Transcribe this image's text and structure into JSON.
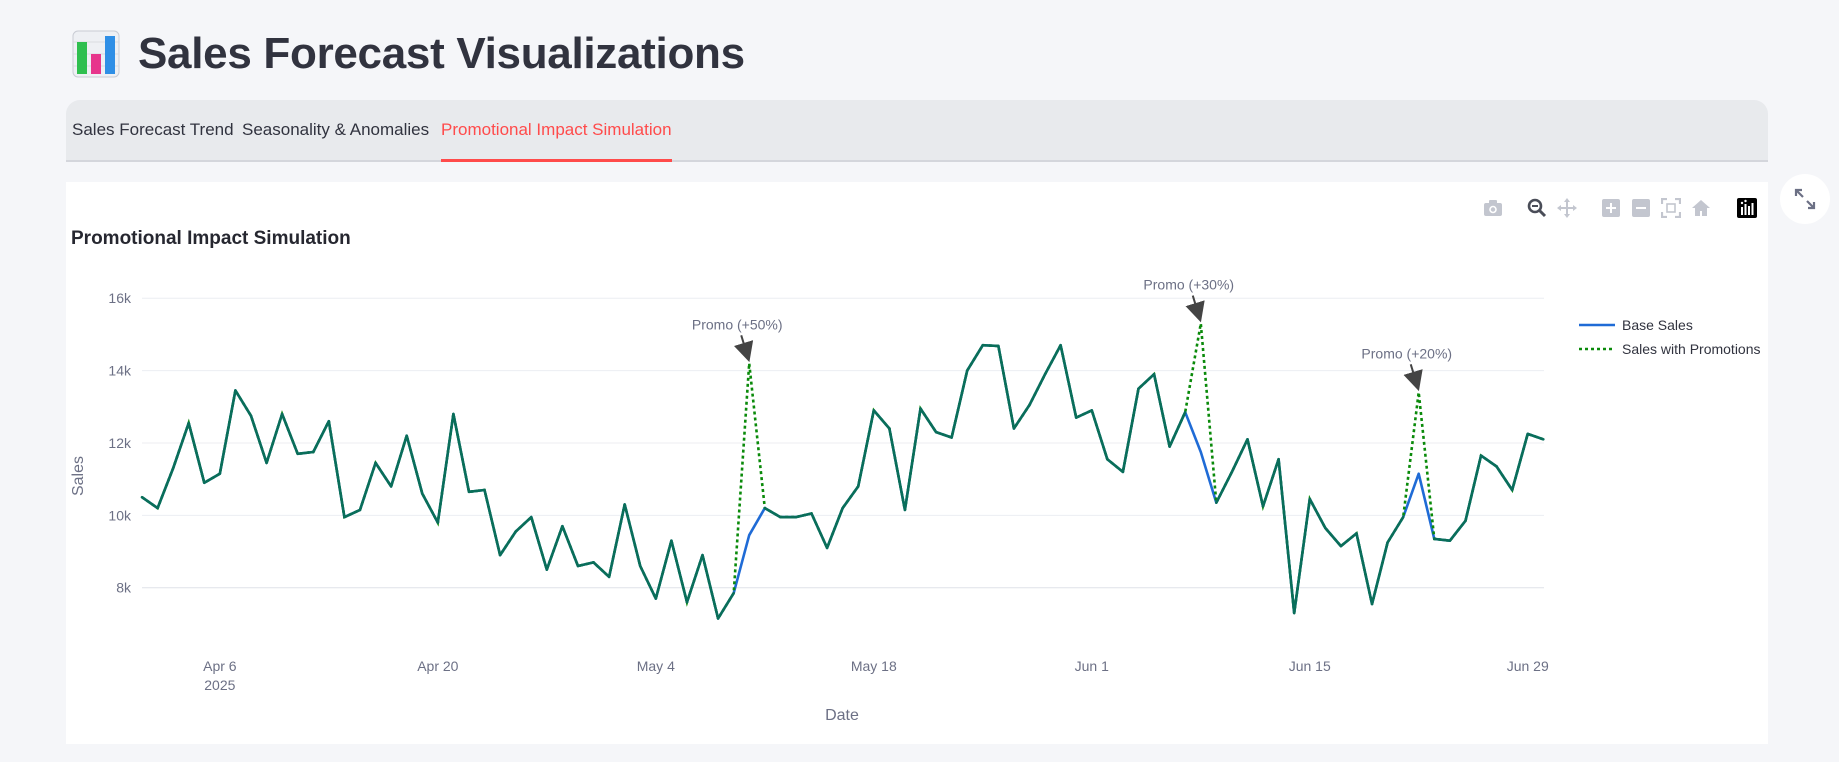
{
  "header": {
    "title": "Sales Forecast Visualizations",
    "logo_icon": "bar-chart-icon"
  },
  "tabs": [
    {
      "label": "Sales Forecast Trend",
      "active": false
    },
    {
      "label": "Seasonality & Anomalies",
      "active": false
    },
    {
      "label": "Promotional Impact Simulation",
      "active": true
    }
  ],
  "colors": {
    "accent": "#ff4b4b",
    "base_sales": "#1f6bd6",
    "promo_sales": "#0a8a0a",
    "overlap": "#0a6e5a"
  },
  "modebar": [
    "camera-icon",
    "zoom-icon",
    "pan-icon",
    "zoom-in-icon",
    "zoom-out-icon",
    "autoscale-icon",
    "reset-axes-icon",
    "plotly-logo-icon"
  ],
  "chart_data": {
    "type": "line",
    "title": "Promotional Impact Simulation",
    "xlabel": "Date",
    "ylabel": "Sales",
    "x_start": "2025-04-01",
    "x_range": [
      "2025-04-01",
      "2025-06-30"
    ],
    "ylim": [
      6500,
      17000
    ],
    "yticks": [
      8000,
      10000,
      12000,
      14000,
      16000
    ],
    "ytick_labels": [
      "8k",
      "10k",
      "12k",
      "14k",
      "16k"
    ],
    "xticks": [
      {
        "date": "2025-04-06",
        "label": "Apr 6",
        "sublabel": "2025"
      },
      {
        "date": "2025-04-20",
        "label": "Apr 20"
      },
      {
        "date": "2025-05-04",
        "label": "May 4"
      },
      {
        "date": "2025-05-18",
        "label": "May 18"
      },
      {
        "date": "2025-06-01",
        "label": "Jun 1"
      },
      {
        "date": "2025-06-15",
        "label": "Jun 15"
      },
      {
        "date": "2025-06-29",
        "label": "Jun 29"
      }
    ],
    "grid": true,
    "legend": "top-right",
    "series": [
      {
        "name": "Base Sales",
        "style": "solid",
        "values": [
          10500,
          10200,
          11300,
          12550,
          10900,
          11150,
          13450,
          12750,
          11450,
          12800,
          11700,
          11750,
          12600,
          9950,
          10150,
          11450,
          10800,
          12200,
          10600,
          9800,
          12800,
          10650,
          10700,
          8900,
          9550,
          9950,
          8500,
          9700,
          8600,
          8700,
          8300,
          10300,
          8600,
          7700,
          9300,
          7600,
          8900,
          7150,
          7850,
          9450,
          10200,
          9950,
          9950,
          10050,
          9100,
          10200,
          10800,
          12900,
          12400,
          10150,
          12950,
          12300,
          12150,
          14000,
          14700,
          14680,
          12400,
          13050,
          13900,
          14700,
          12700,
          12900,
          11550,
          11200,
          13500,
          13900,
          11900,
          12850,
          11750,
          10350,
          11200,
          12100,
          10250,
          11550,
          7300,
          10450,
          9650,
          9150,
          9500,
          7550,
          9250,
          9950,
          11150,
          9350,
          9300,
          9850,
          11650,
          11350,
          10700,
          12250,
          12100
        ],
        "promotion": false
      },
      {
        "name": "Sales with Promotions",
        "style": "dotted",
        "values": [
          10500,
          10200,
          11300,
          12550,
          10900,
          11150,
          13450,
          12750,
          11450,
          12800,
          11700,
          11750,
          12600,
          9950,
          10150,
          11450,
          10800,
          12200,
          10600,
          9800,
          12800,
          10650,
          10700,
          8900,
          9550,
          9950,
          8500,
          9700,
          8600,
          8700,
          8300,
          10300,
          8600,
          7700,
          9300,
          7600,
          8900,
          7150,
          7850,
          14200,
          10200,
          9950,
          9950,
          10050,
          9100,
          10200,
          10800,
          12900,
          12400,
          10150,
          12950,
          12300,
          12150,
          14000,
          14700,
          14680,
          12400,
          13050,
          13900,
          14700,
          12700,
          12900,
          11550,
          11200,
          13500,
          13900,
          11900,
          12850,
          15300,
          10350,
          11200,
          12100,
          10250,
          11550,
          7300,
          10450,
          9650,
          9150,
          9500,
          7550,
          9250,
          9950,
          13400,
          9350,
          9300,
          9850,
          11650,
          11350,
          10700,
          12250,
          12100
        ],
        "promotion": true
      }
    ],
    "annotations": [
      {
        "text": "Promo (+50%)",
        "index": 39,
        "value": 14200
      },
      {
        "text": "Promo (+30%)",
        "index": 68,
        "value": 15300
      },
      {
        "text": "Promo (+20%)",
        "index": 82,
        "value": 13400
      }
    ]
  }
}
